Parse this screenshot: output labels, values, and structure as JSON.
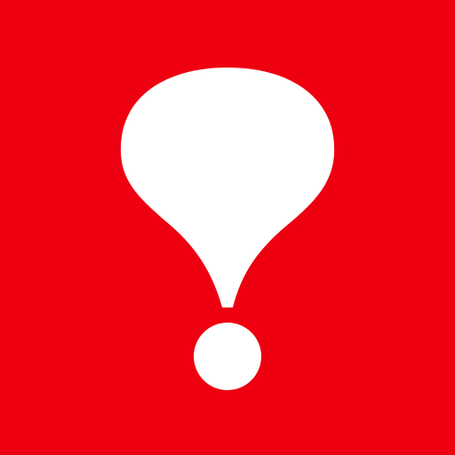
{
  "icon": {
    "name": "exclamation-balloon-icon",
    "background_color": "#EE0010",
    "glyph_color": "#FFFFFF"
  }
}
